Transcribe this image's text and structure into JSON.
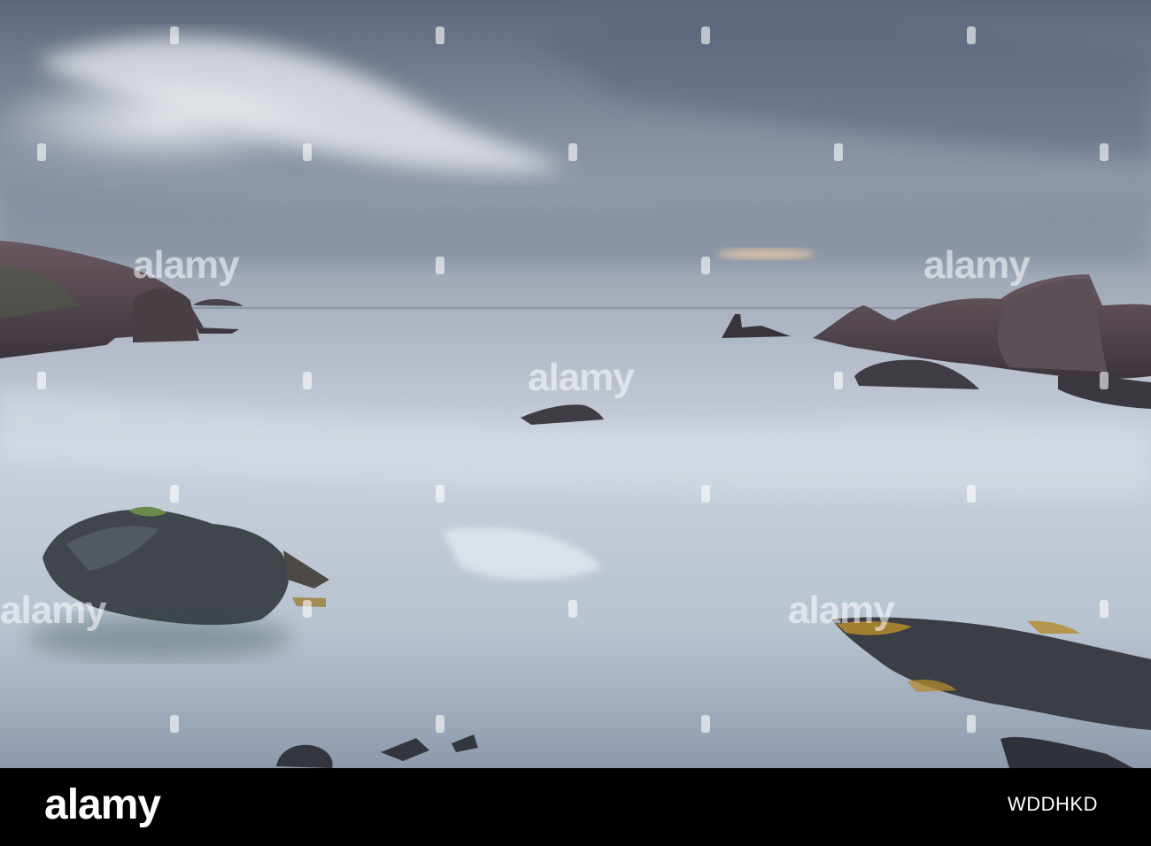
{
  "image": {
    "scene": "stormy coastal seascape with rock stacks",
    "palette": {
      "sky_top": "#5f6b80",
      "sky_light": "#e6e9ee",
      "sea": "#c3ccd8",
      "sea_dark": "#8e9aab",
      "rock": "#3b3f46",
      "rock_warm": "#5a4a52",
      "lichen": "#b58a2c",
      "footer": "#000000"
    }
  },
  "watermark": {
    "text": "alamy",
    "placements": 6
  },
  "footer": {
    "logo": "alamy",
    "image_id": "WDDHKD"
  }
}
